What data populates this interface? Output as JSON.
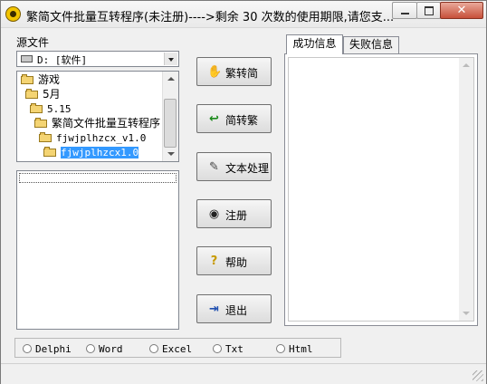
{
  "window": {
    "title": "繁简文件批量互转程序(未注册)---->剩余   30   次数的使用期限,请您支..."
  },
  "left": {
    "source_label": "源文件",
    "drive": "D: [软件]",
    "tree": [
      {
        "label": "游戏",
        "indent": 0,
        "open": false
      },
      {
        "label": "5月",
        "indent": 1,
        "open": false
      },
      {
        "label": "5.15",
        "indent": 2,
        "open": false
      },
      {
        "label": "繁简文件批量互转程序",
        "indent": 3,
        "open": false
      },
      {
        "label": "fjwjplhzcx_v1.0",
        "indent": 4,
        "open": true
      },
      {
        "label": "fjwjplhzcx1.0",
        "indent": 5,
        "open": true,
        "selected": true
      }
    ]
  },
  "buttons": {
    "to_simplified": "繁转简",
    "to_traditional": "简转繁",
    "text_process": "文本处理",
    "register": "注册",
    "help": "帮助",
    "exit": "退出"
  },
  "icons": {
    "to_simplified": "hand-icon",
    "to_traditional": "arrow-return-icon",
    "text_process": "document-edit-icon",
    "register": "eye-icon",
    "help": "question-icon",
    "exit": "exit-door-icon"
  },
  "tabs": [
    {
      "label": "成功信息",
      "active": true
    },
    {
      "label": "失败信息",
      "active": false
    }
  ],
  "radios": [
    "Delphi",
    "Word",
    "Excel",
    "Txt",
    "Html"
  ]
}
